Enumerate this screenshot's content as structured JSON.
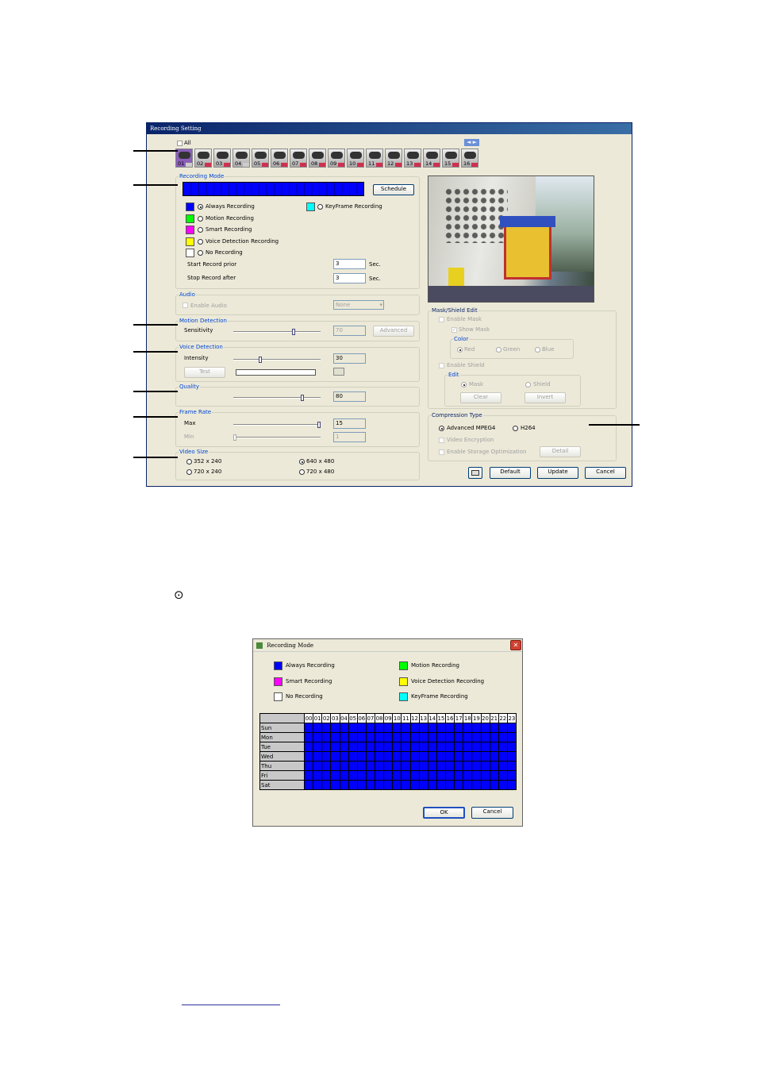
{
  "recording_setting": {
    "title": "Recording Setting",
    "all_label": "All",
    "channels": [
      "01",
      "02",
      "03",
      "04",
      "05",
      "06",
      "07",
      "08",
      "09",
      "10",
      "11",
      "12",
      "13",
      "14",
      "15",
      "16"
    ],
    "nav_arrows": "◄ ►",
    "recording_mode": {
      "legend": "Recording Mode",
      "schedule_button": "Schedule",
      "options": [
        {
          "label": "Always Recording",
          "color": "#0000ff",
          "selected": true
        },
        {
          "label": "Motion Recording",
          "color": "#00ff00",
          "selected": false
        },
        {
          "label": "Smart Recording",
          "color": "#ff00ff",
          "selected": false
        },
        {
          "label": "Voice Detection Recording",
          "color": "#ffff00",
          "selected": false
        },
        {
          "label": "No Recording",
          "color": "#ffffff",
          "selected": false
        }
      ],
      "keyframe": {
        "label": "KeyFrame Recording",
        "color": "#00ffff"
      },
      "start_prior_label": "Start Record prior",
      "start_prior_value": "3",
      "stop_after_label": "Stop Record after",
      "stop_after_value": "3",
      "sec": "Sec."
    },
    "audio": {
      "legend": "Audio",
      "enable_label": "Enable Audio",
      "select_value": "None"
    },
    "motion_detection": {
      "legend": "Motion Detection",
      "sensitivity_label": "Sensitivity",
      "value": "70",
      "level": 0.7,
      "advanced_button": "Advanced"
    },
    "voice_detection": {
      "legend": "Voice Detection",
      "intensity_label": "Intensity",
      "value": "30",
      "level": 0.3,
      "test_button": "Test"
    },
    "quality": {
      "legend": "Quality",
      "value": "80",
      "level": 0.8
    },
    "frame_rate": {
      "legend": "Frame Rate",
      "max_label": "Max",
      "max_value": "15",
      "max_level": 1.0,
      "min_label": "Min",
      "min_value": "1",
      "min_level": 0.0
    },
    "video_size": {
      "legend": "Video Size",
      "options": [
        {
          "label": "352 x 240",
          "selected": false
        },
        {
          "label": "640 x 480",
          "selected": true
        },
        {
          "label": "720 x 240",
          "selected": false
        },
        {
          "label": "720 x 480",
          "selected": false
        }
      ]
    },
    "mask_shield": {
      "legend": "Mask/Shield Edit",
      "enable_mask": "Enable Mask",
      "show_mask": "Show Mask",
      "color_legend": "Color",
      "colors": [
        "Red",
        "Green",
        "Blue"
      ],
      "enable_shield": "Enable Shield",
      "edit_legend": "Edit",
      "edit_options": [
        "Mask",
        "Shield"
      ],
      "clear_button": "Clear",
      "invert_button": "Invert"
    },
    "compression": {
      "legend": "Compression Type",
      "options": [
        {
          "label": "Advanced MPEG4",
          "selected": true
        },
        {
          "label": "H264",
          "selected": false
        }
      ],
      "video_encryption": "Video Encryption",
      "storage_opt": "Enable Storage Optimization",
      "detail_button": "Detail"
    },
    "buttons": {
      "default": "Default",
      "update": "Update",
      "cancel": "Cancel"
    }
  },
  "standalone_radio": "⊙",
  "recording_mode_dialog": {
    "title": "Recording Mode",
    "close": "✕",
    "legend": [
      {
        "label": "Always Recording",
        "color": "#0000ff"
      },
      {
        "label": "Motion Recording",
        "color": "#00ff00"
      },
      {
        "label": "Smart Recording",
        "color": "#ff00ff"
      },
      {
        "label": "Voice Detection Recording",
        "color": "#ffff00"
      },
      {
        "label": "No Recording",
        "color": "#ffffff"
      },
      {
        "label": "KeyFrame Recording",
        "color": "#00ffff"
      }
    ],
    "hours": [
      "00",
      "01",
      "02",
      "03",
      "04",
      "05",
      "06",
      "07",
      "08",
      "09",
      "10",
      "11",
      "12",
      "13",
      "14",
      "15",
      "16",
      "17",
      "18",
      "19",
      "20",
      "21",
      "22",
      "23"
    ],
    "days": [
      "Sun",
      "Mon",
      "Tue",
      "Wed",
      "Thu",
      "Fri",
      "Sat"
    ],
    "ok_button": "OK",
    "cancel_button": "Cancel"
  }
}
